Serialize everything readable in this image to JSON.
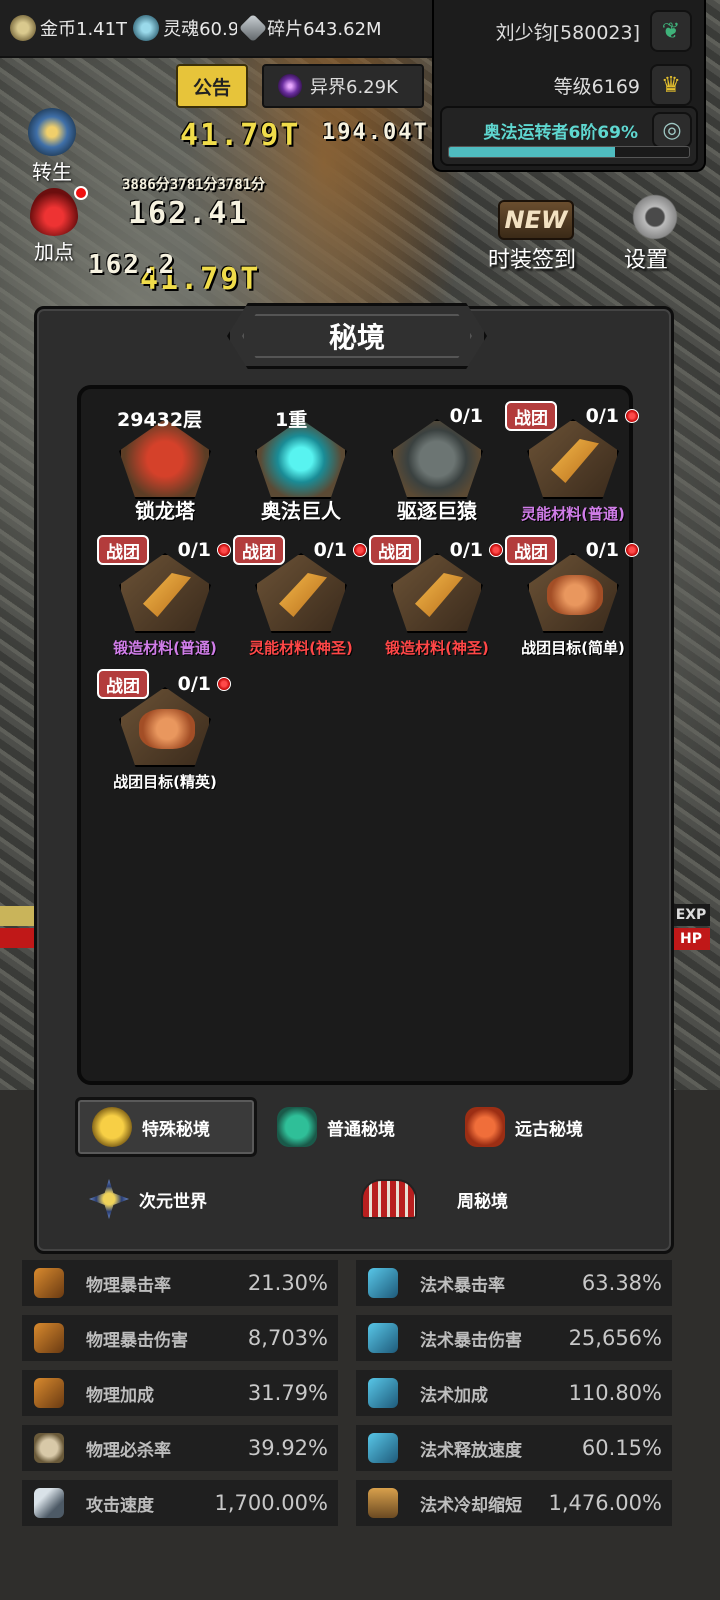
{
  "currencies": [
    {
      "icon": "gold-coin-icon",
      "value": "金币1.41T"
    },
    {
      "icon": "soul-icon",
      "value": "灵魂60.92"
    },
    {
      "icon": "shard-icon",
      "value": "碎片643.62M"
    }
  ],
  "player": {
    "name": "刘少钧[580023]",
    "level": "等级6169",
    "arcane_label": "奥法运转者6阶69%",
    "arcane_progress": 0.69
  },
  "top_buttons": {
    "notice": "公告",
    "otherworld": "异界6.29K"
  },
  "side_buttons": {
    "rebirth": "转生",
    "add_points": "加点",
    "new_badge": "NEW",
    "costume_signin": "时装签到",
    "settings": "设置"
  },
  "battle_texts": {
    "damage_numbers": [
      "41.79T",
      "194.04T",
      "162.41",
      "162.2",
      "3886分3781分3781分"
    ]
  },
  "side_tags": {
    "exp": "EXP",
    "hp": "HP"
  },
  "modal": {
    "title": "秘境",
    "dungeons": [
      {
        "count": "29432层",
        "name": "锁龙塔",
        "emblem": "dragon"
      },
      {
        "count": "1重",
        "name": "奥法巨人",
        "emblem": "arcane"
      },
      {
        "count": "0/1",
        "name": "驱逐巨猿",
        "emblem": "ape"
      },
      {
        "tag": "战团",
        "count": "0/1",
        "name": "灵能材料(普通)",
        "color": "violet",
        "emblem": "pick",
        "dot": true
      },
      {
        "tag": "战团",
        "count": "0/1",
        "name": "锻造材料(普通)",
        "color": "violet",
        "emblem": "pick",
        "dot": true
      },
      {
        "tag": "战团",
        "count": "0/1",
        "name": "灵能材料(神圣)",
        "color": "red",
        "emblem": "pick",
        "dot": true
      },
      {
        "tag": "战团",
        "count": "0/1",
        "name": "锻造材料(神圣)",
        "color": "red",
        "emblem": "pick",
        "dot": true
      },
      {
        "tag": "战团",
        "count": "0/1",
        "name": "战团目标(简单)",
        "color": "white",
        "emblem": "target",
        "dot": true
      },
      {
        "tag": "战团",
        "count": "0/1",
        "name": "战团目标(精英)",
        "color": "white",
        "emblem": "target",
        "dot": true
      }
    ],
    "categories": [
      {
        "label": "特殊秘境",
        "icon": "special-icon",
        "active": true
      },
      {
        "label": "普通秘境",
        "icon": "normal-icon",
        "active": false
      },
      {
        "label": "远古秘境",
        "icon": "ancient-icon",
        "active": false
      },
      {
        "label": "次元世界",
        "icon": "dimension-icon",
        "active": false
      },
      {
        "label": "周秘境",
        "icon": "weekly-icon",
        "active": false
      }
    ]
  },
  "stats": [
    {
      "name": "物理暴击率",
      "value": "21.30%",
      "icon": "physical-crit-icon"
    },
    {
      "name": "法术暴击率",
      "value": "63.38%",
      "icon": "spell-crit-icon"
    },
    {
      "name": "物理暴击伤害",
      "value": "8,703%",
      "icon": "physical-crit-dmg-icon"
    },
    {
      "name": "法术暴击伤害",
      "value": "25,656%",
      "icon": "spell-crit-dmg-icon"
    },
    {
      "name": "物理加成",
      "value": "31.79%",
      "icon": "physical-bonus-icon"
    },
    {
      "name": "法术加成",
      "value": "110.80%",
      "icon": "spell-bonus-icon"
    },
    {
      "name": "物理必杀率",
      "value": "39.92%",
      "icon": "skull-icon"
    },
    {
      "name": "法术释放速度",
      "value": "60.15%",
      "icon": "cast-speed-icon"
    },
    {
      "name": "攻击速度",
      "value": "1,700.00%",
      "icon": "sword-icon"
    },
    {
      "name": "法术冷却缩短",
      "value": "1,476.00%",
      "icon": "hourglass-icon"
    }
  ]
}
